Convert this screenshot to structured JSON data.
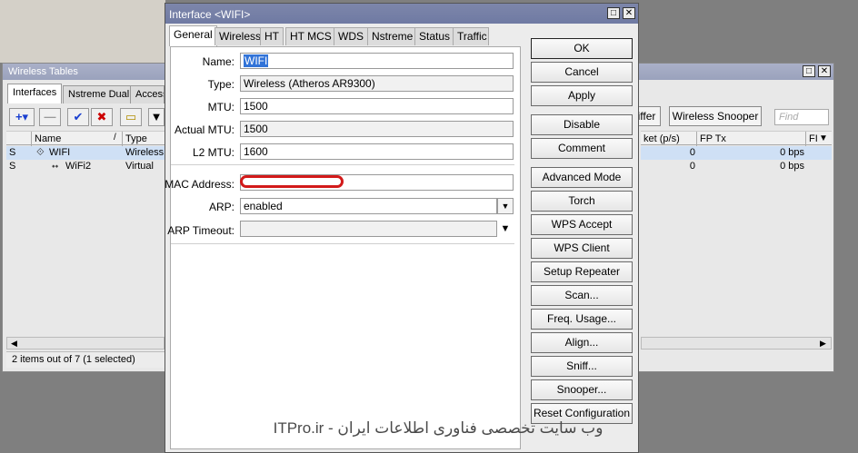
{
  "background_window": {
    "title": "Wireless Tables",
    "tabs": [
      "Interfaces",
      "Nstreme Dual",
      "Access"
    ],
    "toolbar": {
      "sniffer_label": "iffer",
      "snooper_label": "Wireless Snooper",
      "find_placeholder": "Find"
    },
    "left_columns": [
      "Name",
      "Type"
    ],
    "right_columns": [
      "ket (p/s)",
      "FP Tx",
      "FI"
    ],
    "rows": [
      {
        "flag": "S",
        "name": "WIFI",
        "type": "Wireless",
        "packets": "0",
        "fp_tx": "0 bps"
      },
      {
        "flag": "S",
        "name": "WiFi2",
        "type": "Virtual",
        "packets": "0",
        "fp_tx": "0 bps"
      }
    ],
    "status": "2 items out of 7 (1 selected)"
  },
  "dialog": {
    "title": "Interface <WIFI>",
    "tabs": [
      "General",
      "Wireless",
      "HT",
      "HT MCS",
      "WDS",
      "Nstreme",
      "Status",
      "Traffic"
    ],
    "fields": {
      "name_label": "Name:",
      "name_value": "WIFI",
      "type_label": "Type:",
      "type_value": "Wireless (Atheros AR9300)",
      "mtu_label": "MTU:",
      "mtu_value": "1500",
      "actual_mtu_label": "Actual MTU:",
      "actual_mtu_value": "1500",
      "l2mtu_label": "L2 MTU:",
      "l2mtu_value": "1600",
      "mac_label": "MAC Address:",
      "mac_value": "",
      "arp_label": "ARP:",
      "arp_value": "enabled",
      "arp_timeout_label": "ARP Timeout:",
      "arp_timeout_value": ""
    },
    "buttons": [
      "OK",
      "Cancel",
      "Apply",
      "Disable",
      "Comment",
      "Advanced Mode",
      "Torch",
      "WPS Accept",
      "WPS Client",
      "Setup Repeater",
      "Scan...",
      "Freq. Usage...",
      "Align...",
      "Sniff...",
      "Snooper...",
      "Reset Configuration"
    ]
  },
  "watermark": "وب سایت تخصصی فناوری اطلاعات ایران - ITPro.ir"
}
